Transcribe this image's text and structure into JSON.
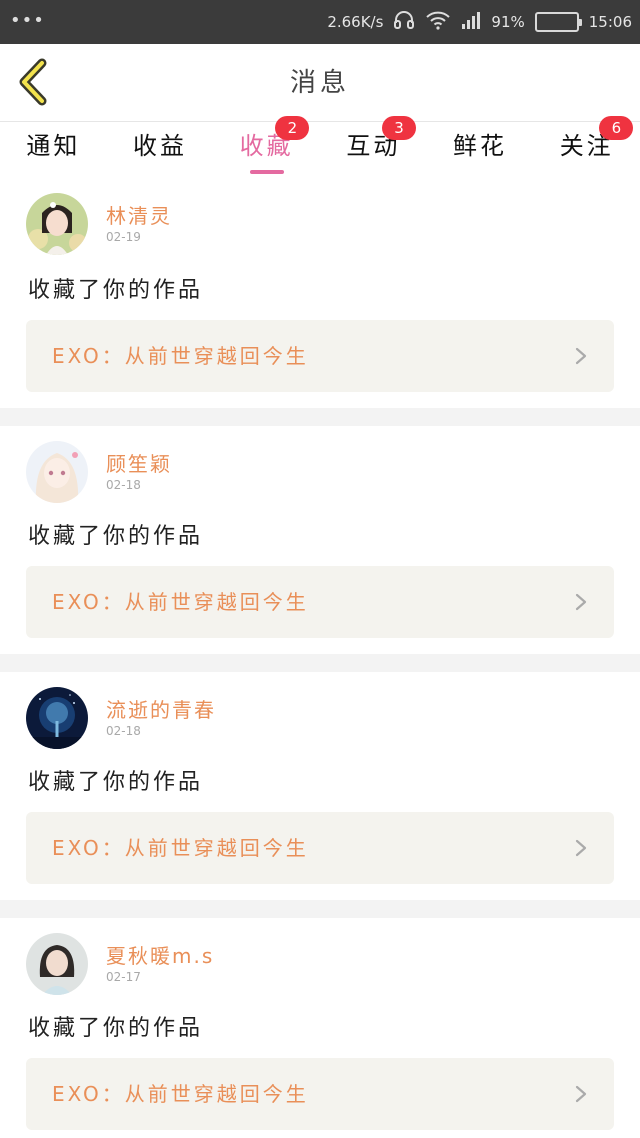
{
  "status_bar": {
    "speed": "2.66K/s",
    "battery_percent": "91%",
    "time": "15:06",
    "battery_level": 0.91
  },
  "header": {
    "title": "消息"
  },
  "tabs": [
    {
      "label": "通知",
      "badge": ""
    },
    {
      "label": "收益",
      "badge": ""
    },
    {
      "label": "收藏",
      "badge": "2",
      "active": true
    },
    {
      "label": "互动",
      "badge": "3"
    },
    {
      "label": "鲜花",
      "badge": ""
    },
    {
      "label": "关注",
      "badge": "6"
    }
  ],
  "items": [
    {
      "name": "林清灵",
      "date": "02-19",
      "action": "收藏了你的作品",
      "work": "EXO：从前世穿越回今生",
      "avatar": "avatar-girl-flowers"
    },
    {
      "name": "顾笙颖",
      "date": "02-18",
      "action": "收藏了你的作品",
      "work": "EXO：从前世穿越回今生",
      "avatar": "avatar-anime-girl"
    },
    {
      "name": "流逝的青春",
      "date": "02-18",
      "action": "收藏了你的作品",
      "work": "EXO：从前世穿越回今生",
      "avatar": "avatar-night-tree"
    },
    {
      "name": "夏秋暖m.s",
      "date": "02-17",
      "action": "收藏了你的作品",
      "work": "EXO：从前世穿越回今生",
      "avatar": "avatar-girl-portrait"
    }
  ],
  "colors": {
    "accent": "#e46aa0",
    "name": "#e98f58",
    "badge": "#ef3340",
    "work_bg": "#f4f3ee"
  }
}
